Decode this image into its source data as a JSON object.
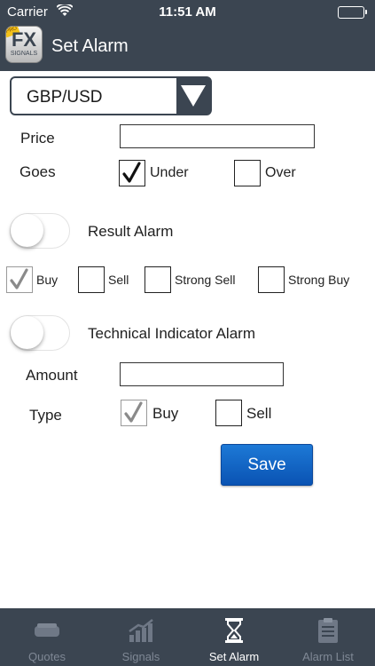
{
  "status_bar": {
    "carrier": "Carrier",
    "time": "11:51 AM"
  },
  "nav": {
    "title": "Set Alarm",
    "app_icon": {
      "fx": "FX",
      "signals": "SIGNALS",
      "badge": "PRO"
    }
  },
  "pair_select": {
    "value": "GBP/USD"
  },
  "price": {
    "label": "Price",
    "value": ""
  },
  "goes": {
    "label": "Goes",
    "options": [
      {
        "label": "Under",
        "checked": true
      },
      {
        "label": "Over",
        "checked": false
      }
    ]
  },
  "result_alarm": {
    "label": "Result Alarm",
    "on": false,
    "options": [
      {
        "label": "Buy",
        "checked": true
      },
      {
        "label": "Sell",
        "checked": false
      },
      {
        "label": "Strong Sell",
        "checked": false
      },
      {
        "label": "Strong Buy",
        "checked": false
      }
    ]
  },
  "technical_alarm": {
    "label": "Technical Indicator Alarm",
    "on": false
  },
  "amount": {
    "label": "Amount",
    "value": ""
  },
  "type": {
    "label": "Type",
    "options": [
      {
        "label": "Buy",
        "checked": true
      },
      {
        "label": "Sell",
        "checked": false
      }
    ]
  },
  "save_label": "Save",
  "tabs": [
    {
      "label": "Quotes",
      "icon": "quotes-icon",
      "active": false
    },
    {
      "label": "Signals",
      "icon": "signals-icon",
      "active": false
    },
    {
      "label": "Set Alarm",
      "icon": "hourglass-icon",
      "active": true
    },
    {
      "label": "Alarm List",
      "icon": "clipboard-icon",
      "active": false
    }
  ],
  "colors": {
    "bar": "#3b4551",
    "save": "#0a53b3",
    "tab_inactive": "#7f8895"
  }
}
